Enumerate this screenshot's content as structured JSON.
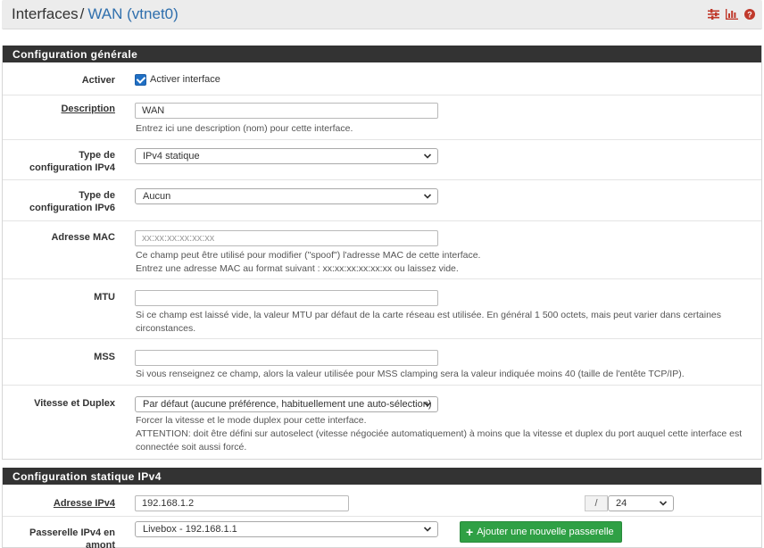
{
  "breadcrumb": {
    "root": "Interfaces",
    "separator": "/",
    "current": "WAN (vtnet0)"
  },
  "header_icons": [
    "sliders-icon",
    "bar-chart-icon",
    "help-icon"
  ],
  "colors": {
    "accent": "#2f6fad",
    "panel_header": "#333333",
    "checkbox": "#1f6fc4",
    "success_button": "#2fa045",
    "header_icon": "#c0392b"
  },
  "general": {
    "title": "Configuration générale",
    "enable": {
      "label": "Activer",
      "checkbox_label": "Activer interface",
      "checked": true
    },
    "description": {
      "label": "Description",
      "value": "WAN",
      "help": "Entrez ici une description (nom) pour cette interface."
    },
    "ipv4_type": {
      "label": "Type de configuration IPv4",
      "value": "IPv4 statique"
    },
    "ipv6_type": {
      "label": "Type de configuration IPv6",
      "value": "Aucun"
    },
    "mac": {
      "label": "Adresse MAC",
      "placeholder": "xx:xx:xx:xx:xx:xx",
      "help_1": "Ce champ peut être utilisé pour modifier (\"spoof\") l'adresse MAC de cette interface.",
      "help_2": "Entrez une adresse MAC au format suivant : xx:xx:xx:xx:xx:xx ou laissez vide."
    },
    "mtu": {
      "label": "MTU",
      "value": "",
      "help": "Si ce champ est laissé vide, la valeur MTU par défaut de la carte réseau est utilisée. En général 1 500 octets, mais peut varier dans certaines circonstances."
    },
    "mss": {
      "label": "MSS",
      "value": "",
      "help": "Si vous renseignez ce champ, alors la valeur utilisée pour MSS clamping sera la valeur indiquée moins 40 (taille de l'entête TCP/IP)."
    },
    "speed": {
      "label": "Vitesse et Duplex",
      "value": "Par défaut (aucune préférence, habituellement une auto-sélection)",
      "help_1": "Forcer la vitesse et le mode duplex pour cette interface.",
      "help_2": "ATTENTION: doit être défini sur autoselect (vitesse négociée automatiquement) à moins que la vitesse et duplex du port auquel cette interface est connectée soit aussi forcé."
    }
  },
  "static_ipv4": {
    "title": "Configuration statique IPv4",
    "address": {
      "label": "Adresse IPv4",
      "value": "192.168.1.2",
      "slash": "/",
      "cidr": "24"
    },
    "gateway": {
      "label": "Passerelle IPv4 en amont",
      "value": "Livebox - 192.168.1.1",
      "add_button": "Ajouter une nouvelle passerelle"
    }
  }
}
